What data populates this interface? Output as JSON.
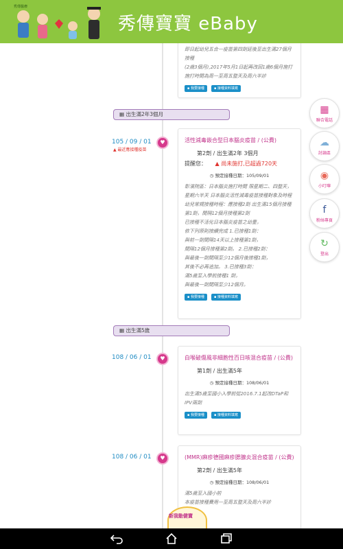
{
  "header": {
    "app_title": "秀傳寶寶 eBaby",
    "logo_small": "秀傳醫療"
  },
  "cards": [
    {
      "desc": "即日起幼兒五合一疫苗第四劑延後至出生滿27個月接種\n(2歲3個月),2017年5月1日起再改回1歲6個月施打 施打時間為周一至周五整天及周六半診",
      "btn1": "我要接種",
      "btn2": "接種資料填寫"
    },
    {
      "title": "活性減毒嵌合型日本腦炎疫苗 / (公費)",
      "dose": "第2劑 / 出生滿2年 3個月",
      "remind_label": "提醒您：",
      "warn": "尚未施打,已超過720天",
      "date": "預定接種日期：105/09/01",
      "desc": "彰濱院區：日本腦炎施打時間 限星期二、四整天，星期六半天 日本腦炎活性減毒疫苗接種對象及時程 幼兒常規接種時程：應接種2劑 出生滿15個月接種第1劑，間隔12個月接種第2劑\n已接種不活化日本腦炎疫苗之幼童，\n依下列原則接續完成 1.已接種1劑：\n與前一劑間隔14天以上接種第1劑，\n間隔12個月接種第2劑。 2.已接種2劑：\n與最後一劑間隔至少12個月後接種1劑，\n其後不必再追加。 3.已接種3劑：\n滿5歲至入學前接種1 劑，\n與最後一劑間隔至少12個月。",
      "btn1": "我要接種",
      "btn2": "接種資料填寫"
    },
    {
      "title": "白喉破傷風非細胞性百日咳混合疫苗 / (公費)",
      "dose": "第1劑 / 出生滿5年",
      "date": "預定接種日期：108/06/01",
      "desc": "出生滿5歲至國小入學前從2016.7.1起改DTaP和IPV兩劑",
      "btn1": "我要接種",
      "btn2": "接種資料填寫"
    },
    {
      "title": "(MMR)麻疹德國麻疹腮腺炎混合疫苗 / (公費)",
      "dose": "第2劑 / 出生滿5年",
      "date": "預定接種日期：108/06/01",
      "desc": "滿5歲至入國小前\n本疫苗接種費用一至周五整天及周六半診"
    }
  ],
  "sections": [
    {
      "label": "出生滿2年3個月"
    },
    {
      "label": "出生滿5歲"
    }
  ],
  "entries": [
    {
      "date": "105 / 09 / 01",
      "note": "最近應接種疫苗"
    },
    {
      "date": "108 / 06 / 01"
    },
    {
      "date": "108 / 06 / 01"
    }
  ],
  "side_buttons": [
    {
      "label": "聯合電話",
      "icon": "phone-icon"
    },
    {
      "label": "討論區",
      "icon": "chat-icon"
    },
    {
      "label": "小叮嚀",
      "icon": "reminder-icon"
    },
    {
      "label": "粉絲專頁",
      "icon": "facebook-icon"
    },
    {
      "label": "登出",
      "icon": "logout-icon"
    }
  ],
  "badge_label": "新我動健寶",
  "colors": {
    "header": "#8dc63f",
    "accent": "#d6398c",
    "link": "#1a8fc8",
    "warn": "#e0342f"
  }
}
